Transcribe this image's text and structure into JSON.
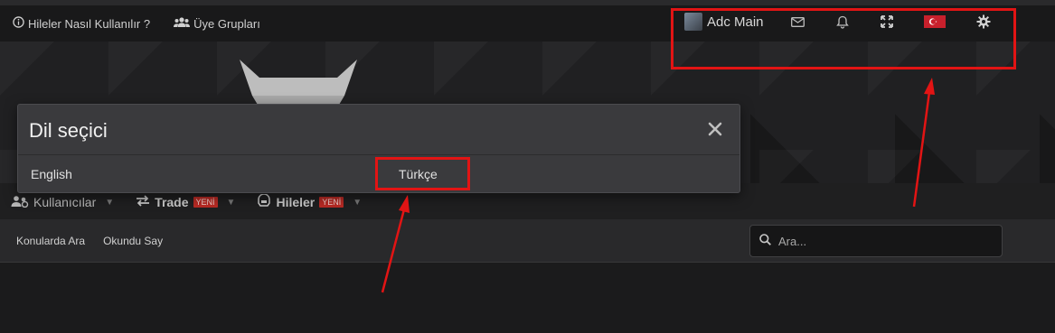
{
  "topbar": {
    "help_link": "Hileler Nasıl Kullanılır ?",
    "groups_link": "Üye Grupları",
    "username": "Adc Main"
  },
  "navbar": {
    "items": [
      {
        "label": "Kullanıcılar"
      },
      {
        "label": "Trade",
        "badge": "YENİ"
      },
      {
        "label": "Hileler",
        "badge": "YENİ"
      }
    ]
  },
  "subbar": {
    "links": [
      "Konularda Ara",
      "Okundu Say"
    ],
    "search_placeholder": "Ara..."
  },
  "modal": {
    "title": "Dil seçici",
    "options": [
      "English",
      "Türkçe"
    ]
  },
  "colors": {
    "highlight": "#e21414",
    "badge": "#b72a24",
    "flag": "#c8202c"
  }
}
